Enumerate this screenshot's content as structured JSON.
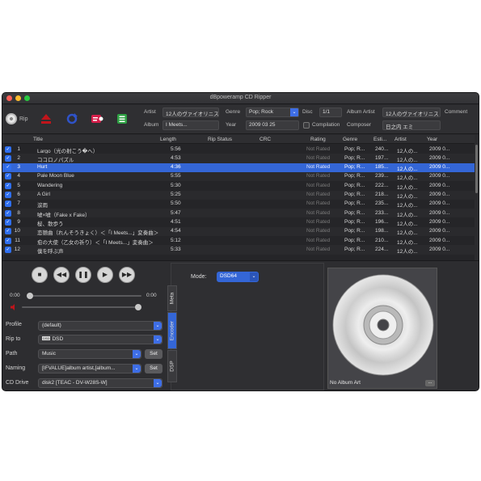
{
  "window": {
    "title": "dBpoweramp CD Ripper"
  },
  "toolbar": {
    "rip_label": "Rip",
    "artist_label": "Artist",
    "artist_value": "12人のヴァイオリニスト",
    "album_label": "Album",
    "album_value": "I Meets...",
    "genre_label": "Genre",
    "genre_value": "Pop; Rock",
    "year_label": "Year",
    "year_value": "2009 03 25",
    "disc_label": "Disc",
    "disc_value": "1/1",
    "compilation_label": "Compilation",
    "album_artist_label": "Album Artist",
    "album_artist_value": "12人のヴァイオリニスト",
    "composer_label": "Composer",
    "composer_value": "日之内 エミ",
    "comment_label": "Comment"
  },
  "tracks": {
    "columns": {
      "title": "Title",
      "length": "Length",
      "rip_status": "Rip Status",
      "crc": "CRC",
      "rating": "Rating",
      "genre": "Genre",
      "esti": "Esti...",
      "artist": "Artist",
      "year": "Year"
    },
    "rows": [
      {
        "num": "1",
        "title": "Largo（光の射こう�へ）",
        "length": "5:56",
        "rating": "Not Rated",
        "genre": "Pop; R...",
        "esti": "240...",
        "artist": "12人の...",
        "year": "2009 0..."
      },
      {
        "num": "2",
        "title": "ココロノパズル",
        "length": "4:53",
        "rating": "Not Rated",
        "genre": "Pop; R...",
        "esti": "197...",
        "artist": "12人の...",
        "year": "2009 0..."
      },
      {
        "num": "3",
        "title": "Hurt",
        "length": "4:36",
        "rating": "Not Rated",
        "genre": "Pop; R...",
        "esti": "185...",
        "artist": "12人の...",
        "year": "2009 0..."
      },
      {
        "num": "4",
        "title": "Pale Moon Blue",
        "length": "5:55",
        "rating": "Not Rated",
        "genre": "Pop; R...",
        "esti": "239...",
        "artist": "12人の...",
        "year": "2009 0..."
      },
      {
        "num": "5",
        "title": "Wandering",
        "length": "5:30",
        "rating": "Not Rated",
        "genre": "Pop; R...",
        "esti": "222...",
        "artist": "12人の...",
        "year": "2009 0..."
      },
      {
        "num": "6",
        "title": "A Girl",
        "length": "5:25",
        "rating": "Not Rated",
        "genre": "Pop; R...",
        "esti": "218...",
        "artist": "12人の...",
        "year": "2009 0..."
      },
      {
        "num": "7",
        "title": "涙雨",
        "length": "5:50",
        "rating": "Not Rated",
        "genre": "Pop; R...",
        "esti": "235...",
        "artist": "12人の...",
        "year": "2009 0..."
      },
      {
        "num": "8",
        "title": "嘘×嘘（Fake x Fake）",
        "length": "5:47",
        "rating": "Not Rated",
        "genre": "Pop; R...",
        "esti": "233...",
        "artist": "12人の...",
        "year": "2009 0..."
      },
      {
        "num": "9",
        "title": "桜、散歩う",
        "length": "4:51",
        "rating": "Not Rated",
        "genre": "Pop; R...",
        "esti": "196...",
        "artist": "12人の...",
        "year": "2009 0..."
      },
      {
        "num": "10",
        "title": "恋戀曲（れんそうきょく）＜「I Meets...」変奏曲＞",
        "length": "4:54",
        "rating": "Not Rated",
        "genre": "Pop; R...",
        "esti": "198...",
        "artist": "12人の...",
        "year": "2009 0..."
      },
      {
        "num": "11",
        "title": "愈の大使（乙女の祈り）＜「I Meets...」変奏曲＞",
        "length": "5:12",
        "rating": "Not Rated",
        "genre": "Pop; R...",
        "esti": "210...",
        "artist": "12人の...",
        "year": "2009 0..."
      },
      {
        "num": "12",
        "title": "僕を呼ぶ声",
        "length": "5:33",
        "rating": "Not Rated",
        "genre": "Pop; R...",
        "esti": "224...",
        "artist": "12人の...",
        "year": "2009 0..."
      }
    ]
  },
  "player": {
    "time_start": "0:00",
    "time_end": "0:00"
  },
  "settings": {
    "profile_label": "Profile",
    "profile_value": "(default)",
    "ripto_label": "Rip to",
    "ripto_value": "DSD",
    "path_label": "Path",
    "path_value": "Music",
    "path_set": "Set",
    "naming_label": "Naming",
    "naming_value": "[IFVALUE]album artist,[album...",
    "naming_set": "Set",
    "cddrive_label": "CD Drive",
    "cddrive_value": "disk2  [TEAC - DV-W28S-W]"
  },
  "tabs": {
    "meta": "Meta",
    "encoder": "Encoder",
    "dsp": "DSP"
  },
  "encoder": {
    "mode_label": "Mode:",
    "mode_value": "DSD64"
  },
  "art": {
    "no_art_label": "No Album Art",
    "more_label": "..."
  }
}
